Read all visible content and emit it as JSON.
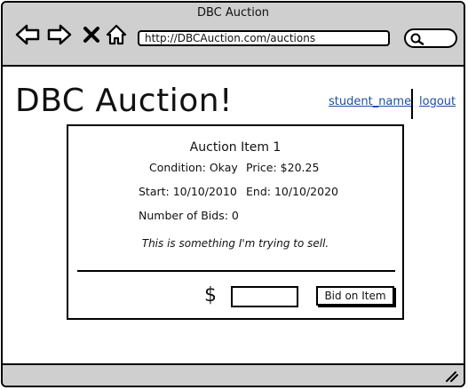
{
  "window": {
    "title": "DBC Auction"
  },
  "toolbar": {
    "url": "http://DBCAuction.com/auctions"
  },
  "icons": {
    "back": "back-arrow-icon",
    "forward": "forward-arrow-icon",
    "stop": "close-icon",
    "home": "home-icon",
    "search": "search-icon",
    "resize": "resize-grip-icon"
  },
  "header": {
    "title": "DBC Auction!",
    "user_link": "student_name",
    "logout_link": "logout"
  },
  "item": {
    "title": "Auction Item 1",
    "condition": "Condition: Okay",
    "price": "Price: $20.25",
    "start": "Start: 10/10/2010",
    "end": "End: 10/10/2020",
    "bids": "Number of Bids: 0",
    "description": "This is something I'm trying to sell."
  },
  "bid": {
    "currency": "$",
    "input_value": "",
    "button_label": "Bid on Item"
  }
}
